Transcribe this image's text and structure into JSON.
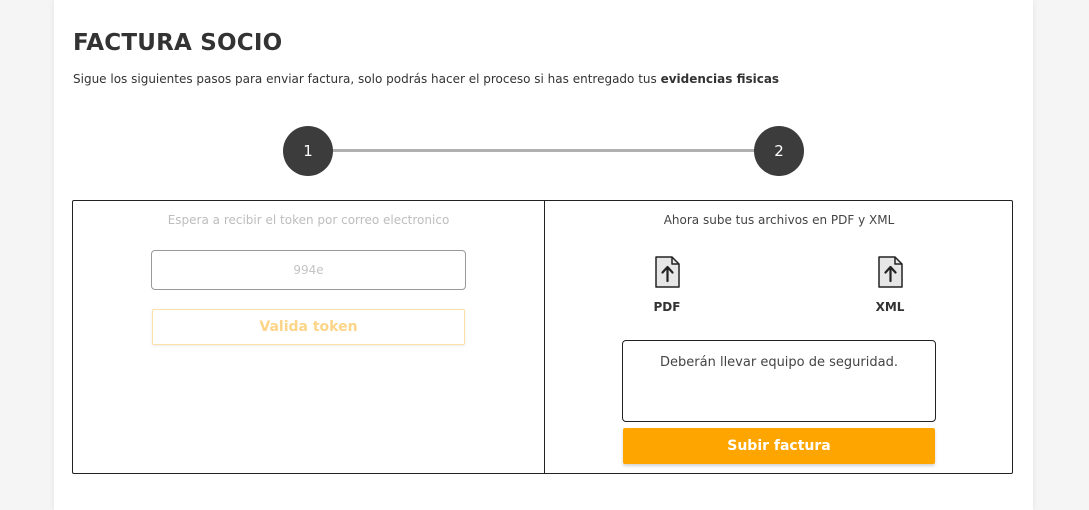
{
  "header": {
    "title": "FACTURA SOCIO",
    "subtitle_prefix": "Sigue los siguientes pasos para enviar factura, solo podrás hacer el proceso si has entregado tus ",
    "subtitle_bold": "evidencias fisicas"
  },
  "stepper": {
    "steps": [
      "1",
      "2"
    ]
  },
  "token_panel": {
    "hint": "Espera a recibir el token por correo electronico",
    "input_placeholder": "994e",
    "input_value": "",
    "validate_label": "Valida token"
  },
  "upload_panel": {
    "hint": "Ahora sube tus archivos en PDF y XML",
    "pdf_label": "PDF",
    "xml_label": "XML",
    "notes_value": "Deberán llevar equipo de seguridad.",
    "submit_label": "Subir factura"
  },
  "icons": {
    "file_upload": "file-upload-icon"
  },
  "colors": {
    "accent": "#ffa500",
    "step": "#3c3c3c",
    "disabled_button_text": "#fdd488"
  }
}
